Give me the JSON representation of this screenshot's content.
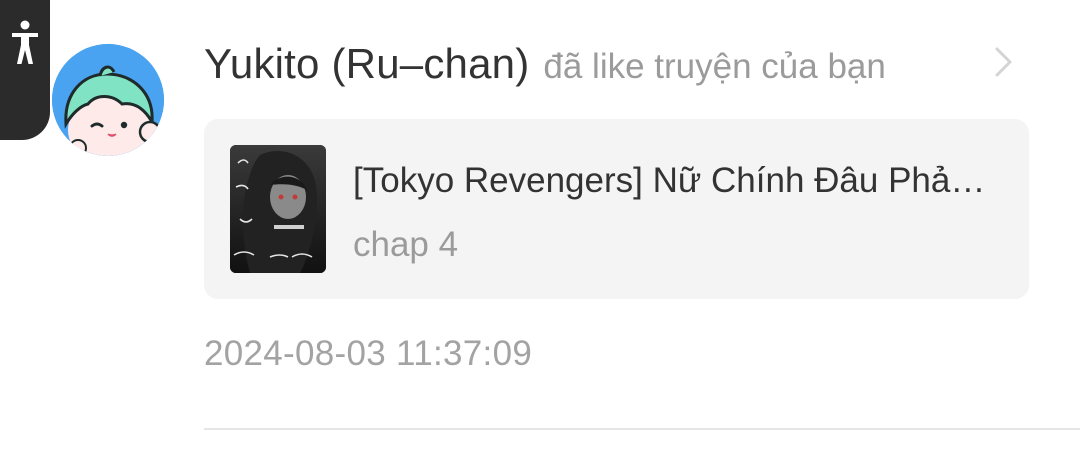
{
  "accessibility": {
    "icon": "accessibility-person-icon"
  },
  "notification": {
    "avatar_icon": "user-avatar",
    "user_name": "Yukito (Ru–chan)",
    "action_text": "đã like truyện của bạn",
    "chevron_icon": "chevron-right-icon",
    "story": {
      "cover_icon": "story-cover-image",
      "title": "[Tokyo Revengers] Nữ Chính Đâu Phả…",
      "chapter": "chap 4"
    },
    "timestamp": "2024-08-03 11:37:09"
  },
  "colors": {
    "accessibility_tab": "#2b2b2b",
    "avatar_background": "#4aa3f0",
    "avatar_hair": "#7fe3c4",
    "card_background": "#f4f4f5",
    "primary_text": "#333333",
    "secondary_text": "#9b9b9b"
  }
}
